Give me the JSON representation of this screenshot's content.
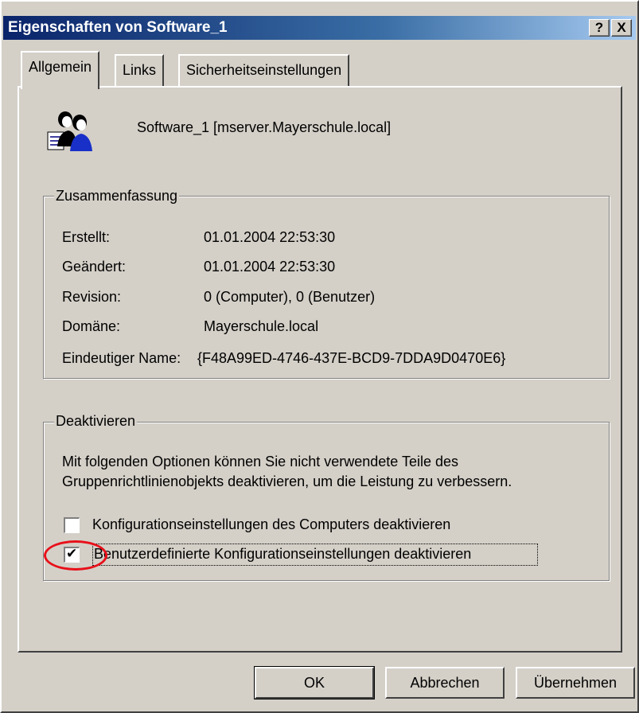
{
  "window": {
    "title": "Eigenschaften von Software_1",
    "help_button": "?",
    "close_button": "X"
  },
  "tabs": [
    {
      "label": "Allgemein",
      "active": true
    },
    {
      "label": "Links",
      "active": false
    },
    {
      "label": "Sicherheitseinstellungen",
      "active": false
    }
  ],
  "object": {
    "icon": "group-policy-object-icon",
    "label": "Software_1 [mserver.Mayerschule.local]"
  },
  "summary": {
    "legend": "Zusammenfassung",
    "rows": [
      {
        "label": "Erstellt:",
        "value": "01.01.2004 22:53:30"
      },
      {
        "label": "Geändert:",
        "value": "01.01.2004 22:53:30"
      },
      {
        "label": "Revision:",
        "value": "0 (Computer), 0 (Benutzer)"
      },
      {
        "label": "Domäne:",
        "value": "Mayerschule.local"
      },
      {
        "label": "Eindeutiger Name:",
        "value": "{F48A99ED-4746-437E-BCD9-7DDA9D0470E6}"
      }
    ]
  },
  "deactivate": {
    "legend": "Deaktivieren",
    "description_line1": "Mit folgenden Optionen können Sie nicht verwendete Teile des",
    "description_line2": "Gruppenrichtlinienobjekts deaktivieren, um die Leistung zu verbessern.",
    "options": [
      {
        "label": "Konfigurationseinstellungen des Computers deaktivieren",
        "checked": false
      },
      {
        "label": "Benutzerdefinierte Konfigurationseinstellungen deaktivieren",
        "checked": true
      }
    ]
  },
  "buttons": {
    "ok": "OK",
    "cancel": "Abbrechen",
    "apply": "Übernehmen"
  },
  "colors": {
    "highlight_circle": "#e8101a",
    "titlebar": "#0a246a"
  }
}
